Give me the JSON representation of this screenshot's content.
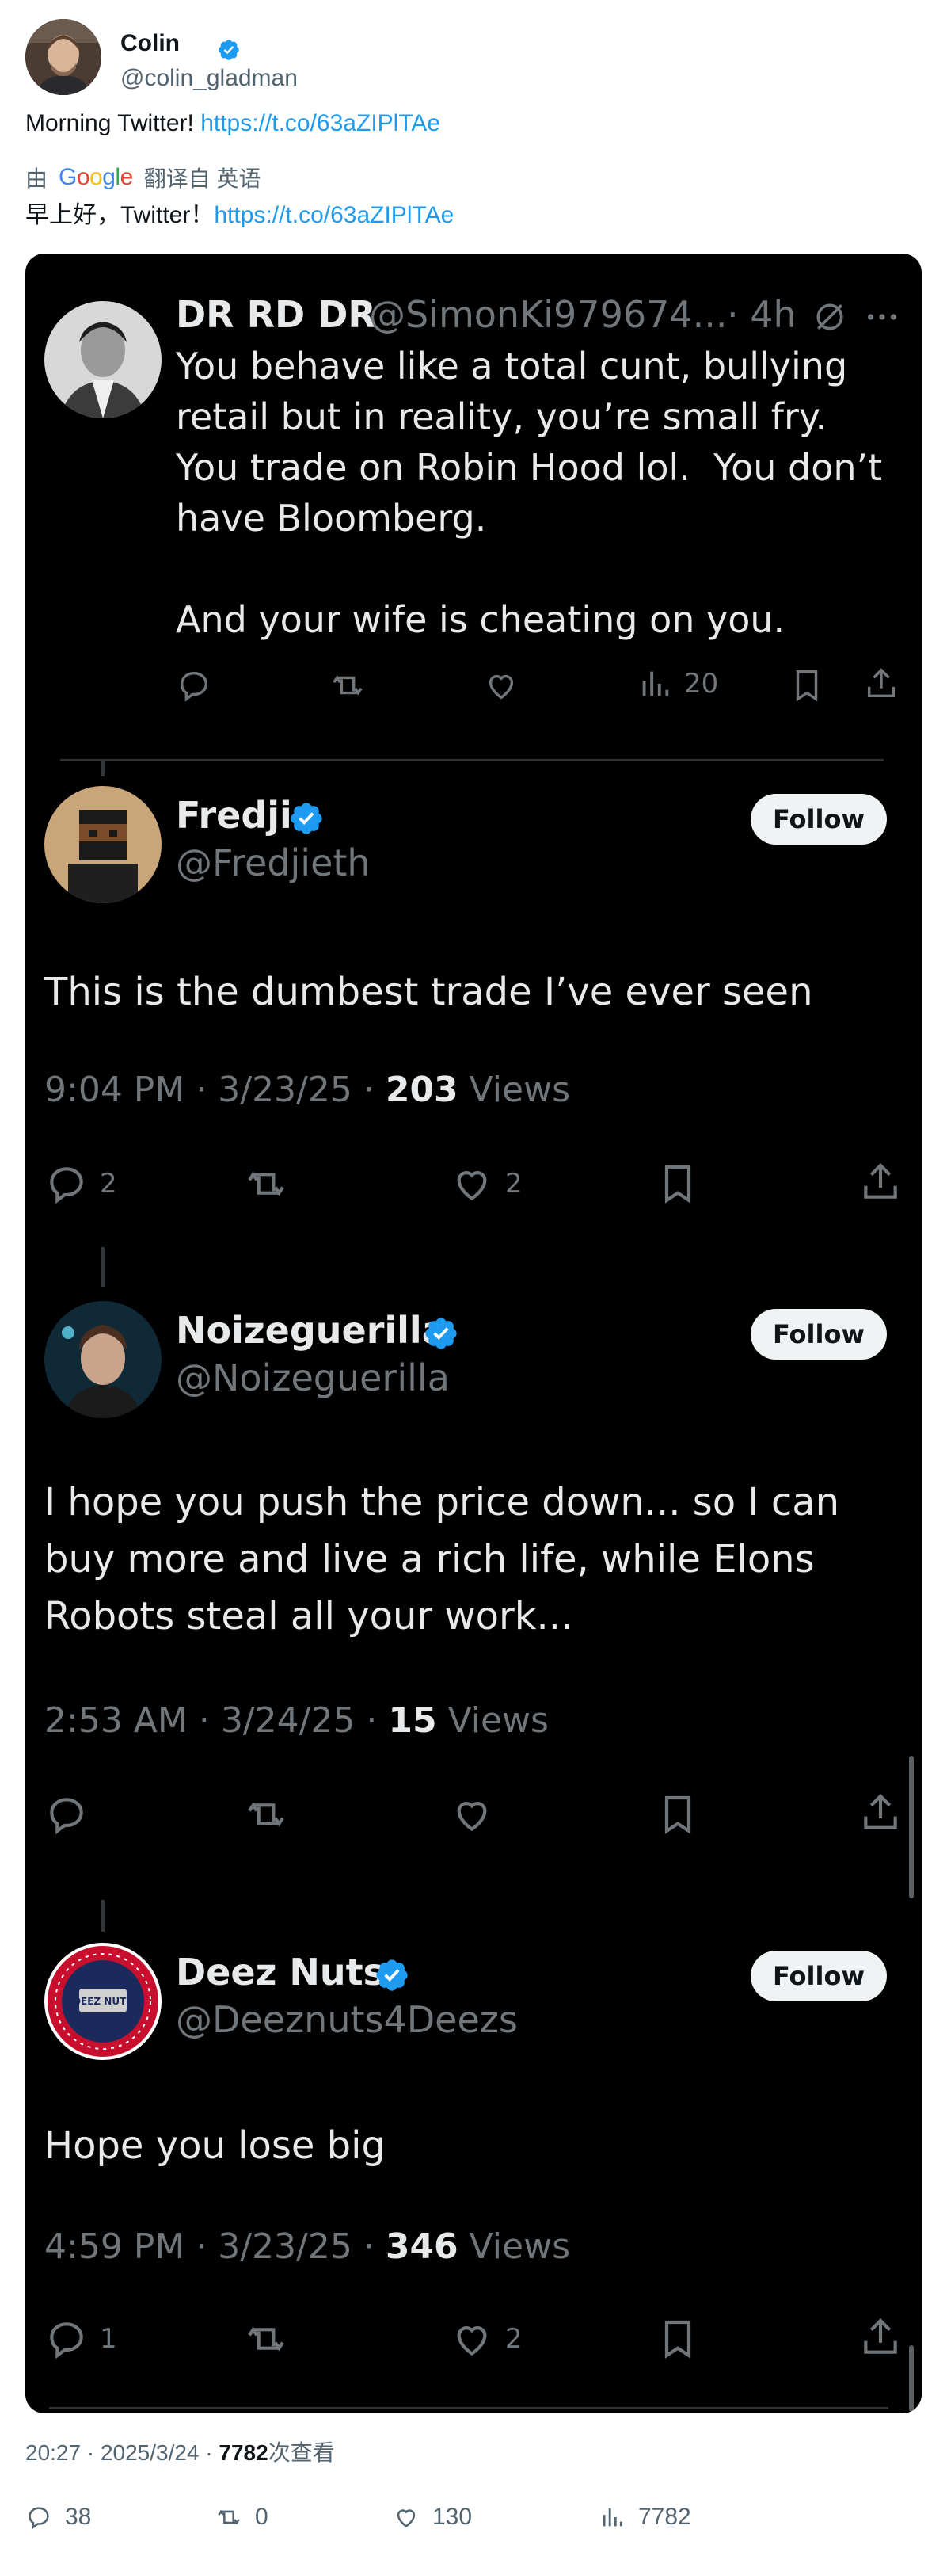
{
  "author": {
    "name": "Colin",
    "handle": "@colin_gladman"
  },
  "tweet": {
    "text": "Morning Twitter! ",
    "link": "https://t.co/63aZIPlTAe",
    "translation_prefix": "由",
    "translation_provider": "Google",
    "translation_suffix": "翻译自 英语",
    "translated_text": "早上好，Twitter！",
    "translated_link": "https://t.co/63aZIPlTAe"
  },
  "screenshot": {
    "top_reply": {
      "name": "DR RD DR",
      "handle": "@SimonKi979674...",
      "time": "· 4h",
      "text": "You behave like a total cunt, bullying retail but in reality, you’re small fry.  You trade on Robin Hood lol.  You don’t have Bloomberg.\n\nAnd your wife is cheating on you.",
      "views": "20"
    },
    "replies": [
      {
        "name": "Fredji",
        "handle": "@Fredjieth",
        "follow_label": "Follow",
        "text": "This is the dumbest trade I’ve ever seen",
        "time": "9:04 PM · 3/23/25 · ",
        "views": "203",
        "views_label": " Views",
        "reply_count": "2",
        "like_count": "2"
      },
      {
        "name": "Noizeguerilla",
        "handle": "@Noizeguerilla",
        "follow_label": "Follow",
        "text": "I hope you push the price down... so I can buy more and live a rich life, while Elons Robots steal all your work...",
        "time": "2:53 AM · 3/24/25 · ",
        "views": "15",
        "views_label": " Views",
        "reply_count": "",
        "like_count": ""
      },
      {
        "name": "Deez Nuts",
        "handle": "@Deeznuts4Deezs",
        "follow_label": "Follow",
        "text": "Hope you lose big",
        "time": "4:59 PM · 3/23/25 · ",
        "views": "346",
        "views_label": " Views",
        "reply_count": "1",
        "like_count": "2"
      }
    ]
  },
  "footer": {
    "timestamp": "20:27 · 2025/3/24 · ",
    "views": "7782",
    "views_label": "次查看",
    "replies": "38",
    "retweets": "0",
    "likes": "130",
    "analytics": "7782"
  },
  "colors": {
    "link": "#1d9bf0",
    "verified": "#1d9bf0",
    "screenshot_bg": "#000000",
    "muted": "#71767b"
  },
  "icons": [
    "verified-icon",
    "reply-icon",
    "retweet-icon",
    "like-icon",
    "views-icon",
    "bookmark-icon",
    "share-icon",
    "grok-icon",
    "more-icon"
  ]
}
